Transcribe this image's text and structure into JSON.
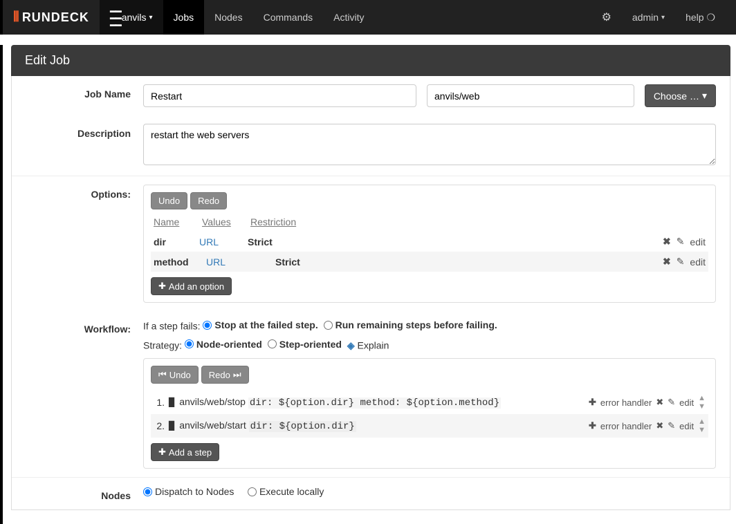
{
  "nav": {
    "brand": "RUNDECK",
    "project": "anvils",
    "items": [
      "Jobs",
      "Nodes",
      "Commands",
      "Activity"
    ],
    "active": "Jobs",
    "user": "admin",
    "help": "help"
  },
  "page": {
    "title": "Edit Job"
  },
  "labels": {
    "job_name": "Job Name",
    "description": "Description",
    "options": "Options:",
    "workflow": "Workflow:",
    "nodes": "Nodes"
  },
  "job": {
    "name": "Restart",
    "group": "anvils/web",
    "choose": "Choose …",
    "description": "restart the web servers"
  },
  "options": {
    "undo": "Undo",
    "redo": "Redo",
    "headers": {
      "name": "Name",
      "values": "Values",
      "restriction": "Restriction"
    },
    "rows": [
      {
        "name": "dir",
        "values": "URL",
        "restriction": "Strict"
      },
      {
        "name": "method",
        "values": "URL",
        "restriction": "Strict"
      }
    ],
    "edit": "edit",
    "add": "Add an option"
  },
  "workflow": {
    "fail_label": "If a step fails:",
    "fail_opt1": "Stop at the failed step.",
    "fail_opt2": "Run remaining steps before failing.",
    "strategy_label": "Strategy:",
    "strategy_opt1": "Node-oriented",
    "strategy_opt2": "Step-oriented",
    "explain": "Explain",
    "undo": "Undo",
    "redo": "Redo",
    "steps": [
      {
        "n": "1.",
        "ref": "anvils/web/stop",
        "args": "dir: ${option.dir} method: ${option.method}"
      },
      {
        "n": "2.",
        "ref": "anvils/web/start",
        "args": "dir: ${option.dir}"
      }
    ],
    "error_handler": "error handler",
    "edit": "edit",
    "add": "Add a step"
  },
  "nodes": {
    "opt1": "Dispatch to Nodes",
    "opt2": "Execute locally"
  }
}
